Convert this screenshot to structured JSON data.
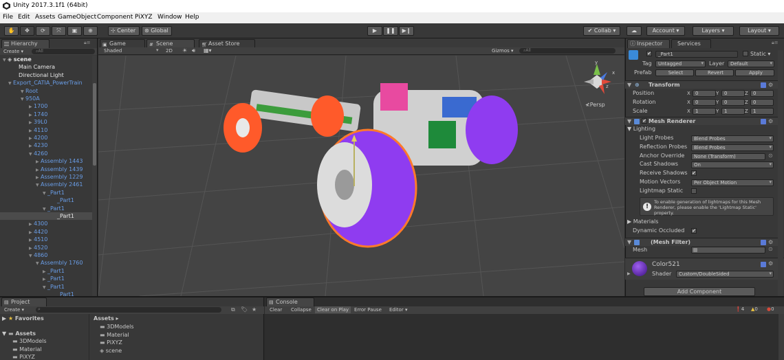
{
  "window": {
    "title": "Unity 2017.3.1f1 (64bit)"
  },
  "menu": [
    "File",
    "Edit",
    "Assets",
    "GameObject",
    "Component",
    "PiXYZ",
    "Window",
    "Help"
  ],
  "toolbar": {
    "center_label": "Center",
    "global_label": "Global",
    "collab_label": "Collab",
    "account_label": "Account",
    "layers_label": "Layers",
    "layout_label": "Layout"
  },
  "hierarchy": {
    "tab_label": "Hierarchy",
    "create_label": "Create",
    "search_placeholder": "All",
    "items": [
      {
        "label": "scene",
        "arrow": "▼"
      },
      {
        "label": "Main Camera",
        "arrow": ""
      },
      {
        "label": "Directional Light",
        "arrow": ""
      },
      {
        "label": "Export_CATIA_PowerTrain",
        "arrow": "▼"
      },
      {
        "label": "Root",
        "arrow": "▼"
      },
      {
        "label": "950A",
        "arrow": "▼"
      },
      {
        "label": "1700",
        "arrow": "▶"
      },
      {
        "label": "1740",
        "arrow": "▶"
      },
      {
        "label": "39L0",
        "arrow": "▶"
      },
      {
        "label": "4110",
        "arrow": "▶"
      },
      {
        "label": "4200",
        "arrow": "▶"
      },
      {
        "label": "4230",
        "arrow": "▶"
      },
      {
        "label": "4260",
        "arrow": "▼"
      },
      {
        "label": "Assembly 1443",
        "arrow": "▶"
      },
      {
        "label": "Assembly 1439",
        "arrow": "▶"
      },
      {
        "label": "Assembly 1229",
        "arrow": "▶"
      },
      {
        "label": "Assembly 2461",
        "arrow": "▼"
      },
      {
        "label": "_Part1",
        "arrow": "▼"
      },
      {
        "label": "_Part1",
        "arrow": ""
      },
      {
        "label": "_Part1",
        "arrow": "▼"
      },
      {
        "label": "_Part1",
        "arrow": ""
      },
      {
        "label": "4300",
        "arrow": "▶"
      },
      {
        "label": "4420",
        "arrow": "▶"
      },
      {
        "label": "4510",
        "arrow": "▶"
      },
      {
        "label": "4520",
        "arrow": "▶"
      },
      {
        "label": "4860",
        "arrow": "▼"
      },
      {
        "label": "Assembly 1760",
        "arrow": "▼"
      },
      {
        "label": "_Part1",
        "arrow": "▶"
      },
      {
        "label": "_Part1",
        "arrow": "▶"
      },
      {
        "label": "_Part1",
        "arrow": "▼"
      },
      {
        "label": "_Part1",
        "arrow": ""
      }
    ]
  },
  "scene": {
    "tabs": [
      "Game",
      "Scene",
      "Asset Store"
    ],
    "shading_mode": "Shaded",
    "mode_2d": "2D",
    "gizmos_label": "Gizmos",
    "search_placeholder": "All",
    "persp_label": "Persp",
    "axis_labels": [
      "y",
      "x",
      "z"
    ]
  },
  "inspector": {
    "tabs": [
      "Inspector",
      "Services"
    ],
    "object_name": "_Part1",
    "static_label": "Static",
    "tag_label": "Tag",
    "tag_value": "Untagged",
    "layer_label": "Layer",
    "layer_value": "Default",
    "prefab_label": "Prefab",
    "prefab_buttons": [
      "Select",
      "Revert",
      "Apply"
    ],
    "transform": {
      "title": "Transform",
      "rows": [
        {
          "label": "Position",
          "x": "0",
          "y": "0",
          "z": "0"
        },
        {
          "label": "Rotation",
          "x": "0",
          "y": "0",
          "z": "0"
        },
        {
          "label": "Scale",
          "x": "1",
          "y": "1",
          "z": "1"
        }
      ],
      "axis": [
        "X",
        "Y",
        "Z"
      ]
    },
    "mesh_renderer": {
      "title": "Mesh Renderer",
      "lighting_label": "Lighting",
      "rows": [
        {
          "label": "Light Probes",
          "value": "Blend Probes"
        },
        {
          "label": "Reflection Probes",
          "value": "Blend Probes"
        },
        {
          "label": "Anchor Override",
          "value": "None (Transform)"
        },
        {
          "label": "Cast Shadows",
          "value": "On"
        },
        {
          "label": "Receive Shadows",
          "value": "✔"
        },
        {
          "label": "Motion Vectors",
          "value": "Per Object Motion"
        },
        {
          "label": "Lightmap Static",
          "value": ""
        }
      ],
      "info_text": "To enable generation of lightmaps for this Mesh Renderer, please enable the 'Lightmap Static' property.",
      "materials_label": "Materials",
      "dynamic_occluded_label": "Dynamic Occluded"
    },
    "mesh_filter": {
      "title": "(Mesh Filter)",
      "mesh_label": "Mesh"
    },
    "material": {
      "name": "Color521",
      "shader_label": "Shader",
      "shader_value": "Custom/DoubleSided"
    },
    "add_component_label": "Add Component"
  },
  "project": {
    "tab_label": "Project",
    "create_label": "Create",
    "favorites_label": "Favorites",
    "assets_label": "Assets",
    "tree": [
      "3DModels",
      "Material",
      "PiXYZ"
    ],
    "breadcrumb": "Assets ▸",
    "files": [
      "3DModels",
      "Material",
      "PiXYZ",
      "scene"
    ]
  },
  "console": {
    "tab_label": "Console",
    "buttons": [
      "Clear",
      "Collapse",
      "Clear on Play",
      "Error Pause",
      "Editor"
    ],
    "counts": [
      "4",
      "0",
      "0"
    ]
  },
  "colors": {
    "selection_blue": "#6a9ee8",
    "purple_wheel": "#8f3cf0",
    "orange_wheel": "#ff5a2a"
  }
}
